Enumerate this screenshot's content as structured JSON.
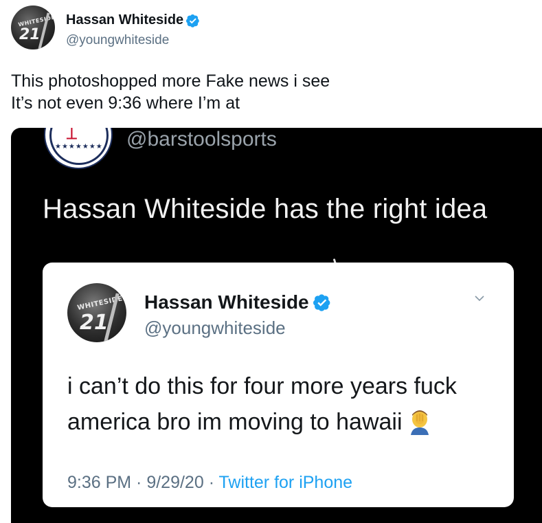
{
  "tweet": {
    "author": {
      "name": "Hassan Whiteside",
      "handle": "@youngwhiteside",
      "avatar_jersey_text": "WHITESIDE",
      "avatar_jersey_number": "21"
    },
    "text_lines": [
      "This photoshopped more Fake news i see",
      "It’s not even 9:36 where I’m at"
    ]
  },
  "media": {
    "account_handle": "@barstoolsports",
    "logo": {
      "stars": "★★★★★★★"
    },
    "caption": "Hassan Whiteside has the right idea",
    "quoted_tweet": {
      "name": "Hassan Whiteside",
      "handle": "@youngwhiteside",
      "avatar_jersey_text": "WHITESIDE",
      "avatar_jersey_number": "21",
      "text": "i can’t do this for four more years fuck america bro im moving to hawaii",
      "emoji": "man-facepalming-emoji",
      "time": "9:36 PM",
      "separator1": " · ",
      "date": "9/29/20",
      "separator2": " · ",
      "source": "Twitter for iPhone"
    }
  },
  "colors": {
    "verified": "#1da1f2",
    "link": "#1da1f2",
    "secondary_text": "#5b7083",
    "media_background": "#000000"
  }
}
